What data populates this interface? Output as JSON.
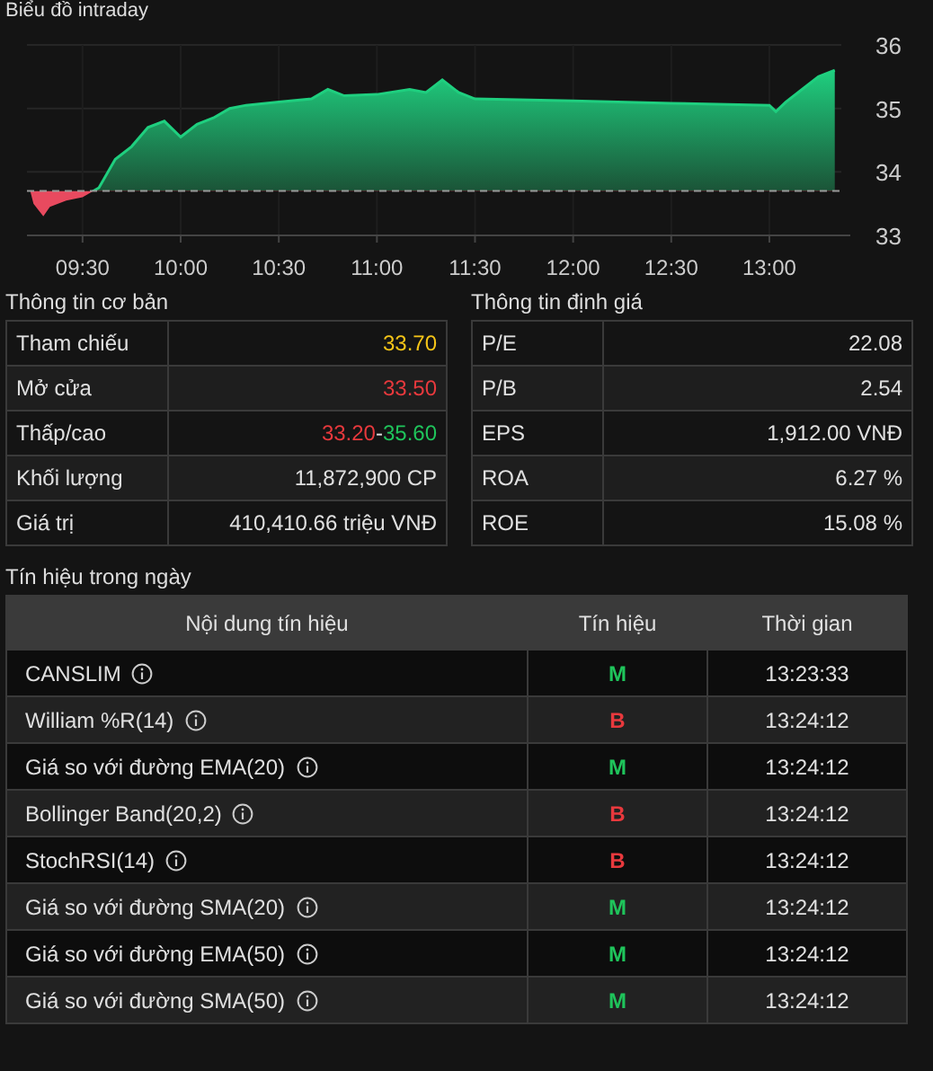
{
  "chart": {
    "title": "Biểu đồ intraday",
    "chart_data": {
      "type": "area",
      "x": [
        554,
        555,
        558,
        560,
        565,
        570,
        575,
        580,
        585,
        590,
        595,
        600,
        605,
        610,
        615,
        620,
        630,
        640,
        645,
        650,
        660,
        670,
        675,
        680,
        685,
        690,
        720,
        750,
        780,
        782,
        785,
        790,
        795,
        800
      ],
      "series": [
        {
          "color": "#1fcf7f",
          "values": [
            33.7,
            33.5,
            33.3,
            33.45,
            33.55,
            33.6,
            33.75,
            34.2,
            34.4,
            34.7,
            34.8,
            34.55,
            34.75,
            34.85,
            35.0,
            35.05,
            35.1,
            35.15,
            35.3,
            35.2,
            35.22,
            35.3,
            35.25,
            35.45,
            35.25,
            35.15,
            35.12,
            35.08,
            35.05,
            34.95,
            35.1,
            35.3,
            35.5,
            35.6
          ]
        }
      ],
      "xlim": [
        553,
        802
      ],
      "ylim": [
        33,
        36
      ],
      "xticks": [
        {
          "value": 570,
          "label": "09:30"
        },
        {
          "value": 600,
          "label": "10:00"
        },
        {
          "value": 630,
          "label": "10:30"
        },
        {
          "value": 660,
          "label": "11:00"
        },
        {
          "value": 690,
          "label": "11:30"
        },
        {
          "value": 720,
          "label": "12:00"
        },
        {
          "value": 750,
          "label": "12:30"
        },
        {
          "value": 780,
          "label": "13:00"
        }
      ],
      "yticks": [
        33,
        34,
        35,
        36
      ],
      "grid": true,
      "ref_lines": [
        {
          "axis": "y",
          "value": 33.7
        }
      ]
    }
  },
  "basic": {
    "title": "Thông tin cơ bản",
    "rows": [
      {
        "label": "Tham chiếu",
        "values": [
          {
            "text": "33.70",
            "color": "#f5c518"
          }
        ]
      },
      {
        "label": "Mở cửa",
        "values": [
          {
            "text": "33.50",
            "color": "#e8393d"
          }
        ]
      },
      {
        "label": "Thấp/cao",
        "values": [
          {
            "text": "33.20",
            "color": "#e8393d"
          },
          {
            "text": "-",
            "color": "#e0e0e0"
          },
          {
            "text": "35.60",
            "color": "#1fc45b"
          }
        ]
      },
      {
        "label": "Khối lượng",
        "values": [
          {
            "text": "11,872,900 CP",
            "color": "#e0e0e0"
          }
        ]
      },
      {
        "label": "Giá trị",
        "values": [
          {
            "text": "410,410.66 triệu VNĐ",
            "color": "#e0e0e0"
          }
        ]
      }
    ]
  },
  "valuation": {
    "title": "Thông tin định giá",
    "rows": [
      {
        "label": "P/E",
        "value": "22.08"
      },
      {
        "label": "P/B",
        "value": "2.54"
      },
      {
        "label": "EPS",
        "value": "1,912.00 VNĐ"
      },
      {
        "label": "ROA",
        "value": "6.27 %"
      },
      {
        "label": "ROE",
        "value": "15.08 %"
      }
    ]
  },
  "signals": {
    "title": "Tín hiệu trong ngày",
    "columns": [
      "Nội dung tín hiệu",
      "Tín hiệu",
      "Thời gian"
    ],
    "rows": [
      {
        "name": "CANSLIM",
        "signal": "M",
        "color": "#1fc45b",
        "time": "13:23:33"
      },
      {
        "name": "William %R(14)",
        "signal": "B",
        "color": "#e8393d",
        "time": "13:24:12"
      },
      {
        "name": "Giá so với đường EMA(20)",
        "signal": "M",
        "color": "#1fc45b",
        "time": "13:24:12"
      },
      {
        "name": "Bollinger Band(20,2)",
        "signal": "B",
        "color": "#e8393d",
        "time": "13:24:12"
      },
      {
        "name": "StochRSI(14)",
        "signal": "B",
        "color": "#e8393d",
        "time": "13:24:12"
      },
      {
        "name": "Giá so với đường SMA(20)",
        "signal": "M",
        "color": "#1fc45b",
        "time": "13:24:12"
      },
      {
        "name": "Giá so với đường EMA(50)",
        "signal": "M",
        "color": "#1fc45b",
        "time": "13:24:12"
      },
      {
        "name": "Giá so với đường SMA(50)",
        "signal": "M",
        "color": "#1fc45b",
        "time": "13:24:12"
      }
    ]
  }
}
